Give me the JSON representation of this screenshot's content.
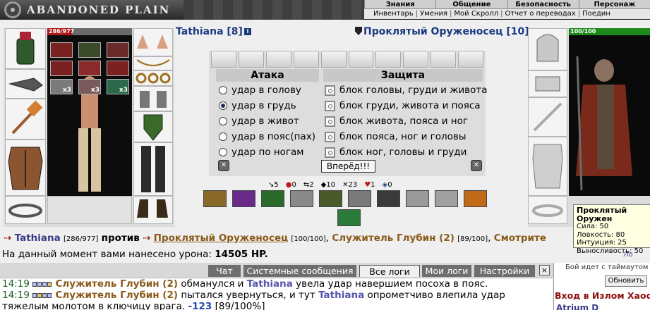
{
  "header": {
    "logo_text": "ABANDONED PLAIN",
    "menu_top": [
      "Знания",
      "Общение",
      "Безопасность",
      "Персонаж"
    ],
    "menu_sub": [
      "Инвентарь",
      "Умения",
      "Мой Скролл",
      "Отчет о переводах",
      "Поедин"
    ]
  },
  "player": {
    "name": "Tathiana",
    "level_text": "[8]",
    "hp_text": "286/977",
    "hp_fraction": 0.293,
    "item_counts": [
      "x3",
      "x3",
      "x3"
    ]
  },
  "enemy": {
    "name": "Проклятый Оруженосец",
    "level_text": "[10]",
    "hp_text": "100/100",
    "hp_fraction": 1.0
  },
  "battle": {
    "attack_title": "Атака",
    "defense_title": "Защита",
    "attacks": [
      "удар в голову",
      "удар в грудь",
      "удар в живот",
      "удар в пояс(пах)",
      "удар по ногам"
    ],
    "attack_selected_index": 1,
    "defenses": [
      "блок головы, груди и живота",
      "блок груди, живота и пояса",
      "блок живота, пояса и ног",
      "блок пояса, ног и головы",
      "блок ног, головы и груди"
    ],
    "forward_label": "Вперёд!!!"
  },
  "stats": [
    "5",
    "0",
    "2",
    "10",
    "23",
    "1",
    "0"
  ],
  "fight_line": {
    "player_name": "Tathiana",
    "player_hp": "[286/977]",
    "vs": "против",
    "enemy1": "Проклятый Оруженосец",
    "enemy1_hp": "[100/100]",
    "enemy2": "Служитель Глубин (2)",
    "enemy2_hp": "[89/100]",
    "tail": "Смотрите"
  },
  "damage": {
    "prefix": "На данный момент вами нанесено урона:",
    "value": "14505 HP."
  },
  "tooltip": {
    "title": "Проклятый Оружен",
    "lines": [
      "Сила: 50",
      "Ловкость: 80",
      "Интуиция: 25",
      "Выносливость: 50"
    ]
  },
  "chat": {
    "tabs": [
      "Чат",
      "Системные сообщения",
      "Все логи",
      "Мои логи",
      "Настройки"
    ],
    "active_tab_index": 2,
    "close_label": "×",
    "lines": [
      {
        "time": "14:19",
        "actor": "Служитель Глубин (2)",
        "t1": " обманулся и ",
        "target": "Tathiana",
        "t2": " увела удар навершием посоха в пояс."
      },
      {
        "time": "14:19",
        "actor": "Служитель Глубин (2)",
        "t1": " пытался увернуться, и тут ",
        "target": "Tathiana",
        "t2": " опрометчиво влепила удар"
      },
      {
        "time": "",
        "actor": "",
        "t1": "тяжелым молотом в ключицу врага. ",
        "target": "-123",
        "t2": " [89/100%]"
      }
    ]
  },
  "sidebar": {
    "note": "Бой идет с таймаутом",
    "refresh_label": "Обновить",
    "title": "Вход в Излом Хаос",
    "user": "Atrium D",
    "lo_link": "Ло"
  },
  "colors": {
    "hp_red": "#b01818",
    "hp_green": "#1c8a1c",
    "accent_blue": "#1b3a82"
  }
}
